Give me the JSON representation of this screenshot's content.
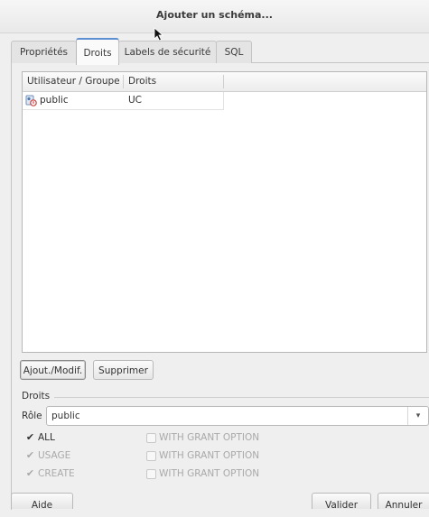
{
  "window": {
    "title": "Ajouter un schéma..."
  },
  "tabs": [
    {
      "label": "Propriétés",
      "active": false
    },
    {
      "label": "Droits",
      "active": true
    },
    {
      "label": "Labels de sécurité",
      "active": false
    },
    {
      "label": "SQL",
      "active": false
    }
  ],
  "privileges_list": {
    "columns": [
      "Utilisateur / Groupe",
      "Droits"
    ],
    "rows": [
      {
        "user": "public",
        "rights": "UC",
        "icon": "group-icon"
      }
    ]
  },
  "buttons": {
    "add_modify": "Ajout./Modif.",
    "delete": "Supprimer",
    "help": "Aide",
    "ok": "Valider",
    "cancel": "Annuler"
  },
  "privileges_group": {
    "label": "Droits",
    "role_label": "Rôle",
    "role_value": "public",
    "items": [
      {
        "label": "ALL",
        "checked": true,
        "enabled": true,
        "grant_option": "WITH GRANT OPTION",
        "grant_checked": false
      },
      {
        "label": "USAGE",
        "checked": true,
        "enabled": false,
        "grant_option": "WITH GRANT OPTION",
        "grant_checked": false
      },
      {
        "label": "CREATE",
        "checked": true,
        "enabled": false,
        "grant_option": "WITH GRANT OPTION",
        "grant_checked": false
      }
    ]
  },
  "colors": {
    "accent": "#5b8fd1",
    "background": "#efefef"
  }
}
